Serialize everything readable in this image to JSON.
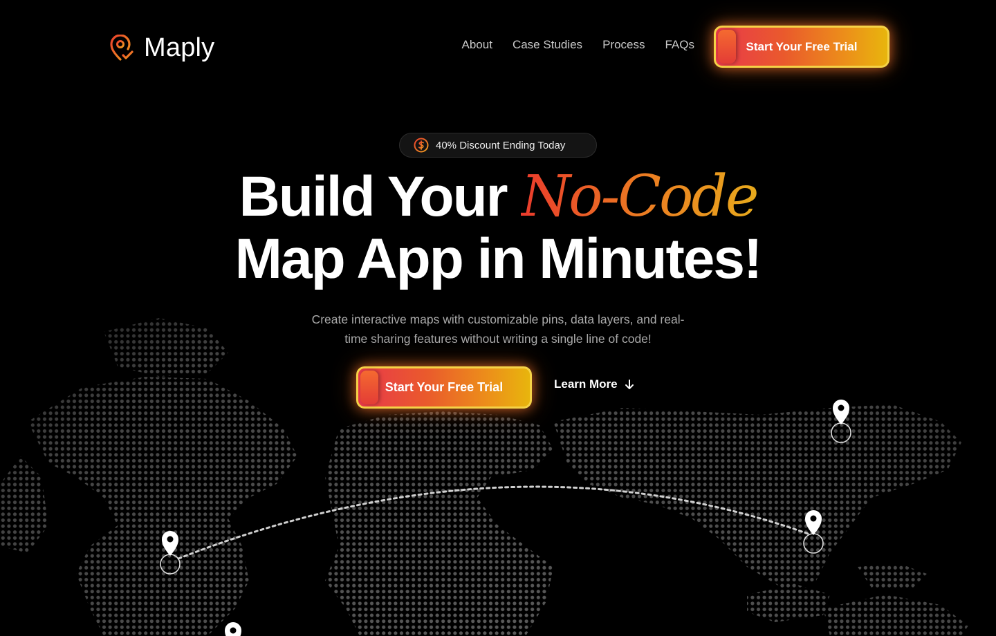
{
  "brand": {
    "name": "Maply",
    "logo_icon": "map-pin-check-icon",
    "accent_colors": [
      "#e8394b",
      "#ec8e1a",
      "#e8b50d"
    ]
  },
  "nav": {
    "links": [
      "About",
      "Case Studies",
      "Process",
      "FAQs"
    ],
    "cta_label": "Start Your Free Trial"
  },
  "hero": {
    "badge": {
      "icon": "dollar-circle-icon",
      "text": "40% Discount Ending Today"
    },
    "headline_part1": "Build Your ",
    "headline_accent": "No-Code",
    "headline_part2": "Map App in Minutes!",
    "subtext_line1": "Create interactive maps with customizable pins, data layers, and real-",
    "subtext_line2": "time sharing features without writing a single line of code!",
    "primary_cta": "Start Your Free Trial",
    "secondary_cta": "Learn More",
    "secondary_icon": "arrow-down-icon"
  },
  "map": {
    "background": "dotted-world-map",
    "pins": [
      "map-pin-icon",
      "map-pin-icon",
      "map-pin-icon",
      "map-pin-icon"
    ],
    "route": "dashed-arc"
  }
}
